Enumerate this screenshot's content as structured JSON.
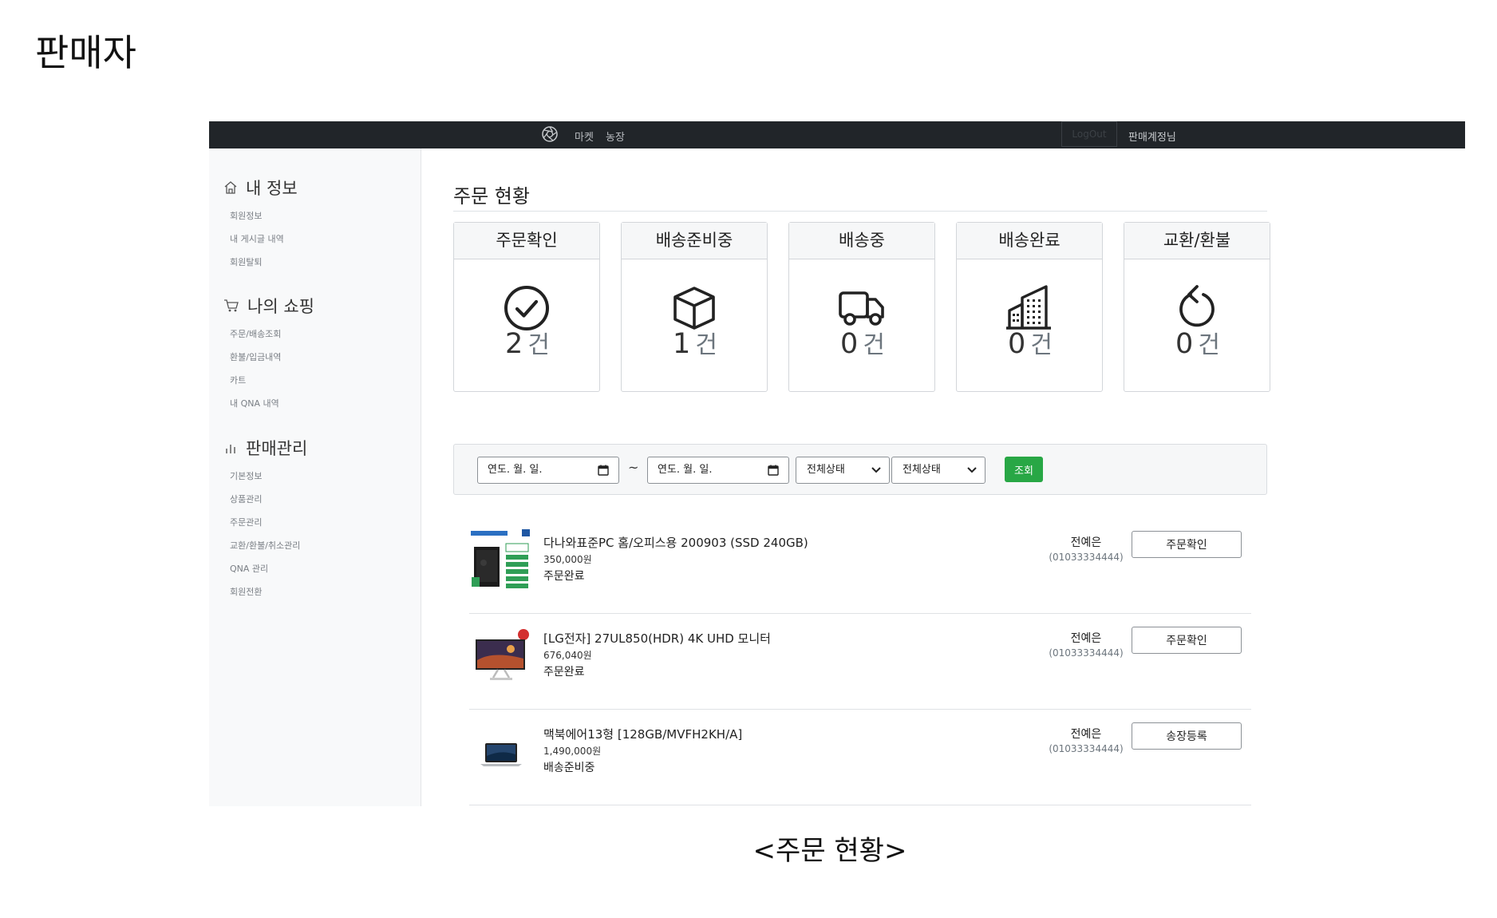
{
  "document": {
    "title": "판매자",
    "caption": "<주문 현황>"
  },
  "navbar": {
    "logo_icon": "aperture-icon",
    "links": [
      "마켓",
      "농장"
    ],
    "logout_label": "LogOut",
    "user_label": "판매계정님"
  },
  "sidebar": {
    "groups": [
      {
        "title": "내 정보",
        "icon": "house-icon",
        "items": [
          "회원정보",
          "내 게시글 내역",
          "회원탈퇴"
        ]
      },
      {
        "title": "나의 쇼핑",
        "icon": "cart-icon",
        "items": [
          "주문/배송조회",
          "환불/입금내역",
          "카트",
          "내 QNA 내역"
        ]
      },
      {
        "title": "판매관리",
        "icon": "bar-chart-icon",
        "items": [
          "기본정보",
          "상품관리",
          "주문관리",
          "교환/환불/취소관리",
          "QNA 관리",
          "회원전환"
        ]
      }
    ]
  },
  "main": {
    "title": "주문 현황",
    "status_cards": [
      {
        "label": "주문확인",
        "count": "2",
        "unit": "건",
        "icon": "check-circle-icon"
      },
      {
        "label": "배송준비중",
        "count": "1",
        "unit": "건",
        "icon": "box-icon"
      },
      {
        "label": "배송중",
        "count": "0",
        "unit": "건",
        "icon": "truck-icon"
      },
      {
        "label": "배송완료",
        "count": "0",
        "unit": "건",
        "icon": "building-icon"
      },
      {
        "label": "교환/환불",
        "count": "0",
        "unit": "건",
        "icon": "arrow-counterclockwise-icon"
      }
    ],
    "filter": {
      "date_from_placeholder": "연도. 월. 일.",
      "date_to_placeholder": "연도. 월. 일.",
      "separator": "~",
      "select1_value": "전체상태",
      "select2_value": "전체상태",
      "search_label": "조회",
      "search_color": "#28a745"
    },
    "orders": [
      {
        "name": "다나와표준PC 홈/오피스용 200903 (SSD 240GB)",
        "price": "350,000원",
        "status": "주문완료",
        "buyer": "전예은",
        "phone": "(01033334444)",
        "action": "주문확인",
        "thumb": "desktop-pc-image"
      },
      {
        "name": "[LG전자] 27UL850(HDR) 4K UHD 모니터",
        "price": "676,040원",
        "status": "주문완료",
        "buyer": "전예은",
        "phone": "(01033334444)",
        "action": "주문확인",
        "thumb": "monitor-image"
      },
      {
        "name": "맥북에어13형 [128GB/MVFH2KH/A]",
        "price": "1,490,000원",
        "status": "배송준비중",
        "buyer": "전예은",
        "phone": "(01033334444)",
        "action": "송장등록",
        "thumb": "laptop-image"
      }
    ]
  }
}
